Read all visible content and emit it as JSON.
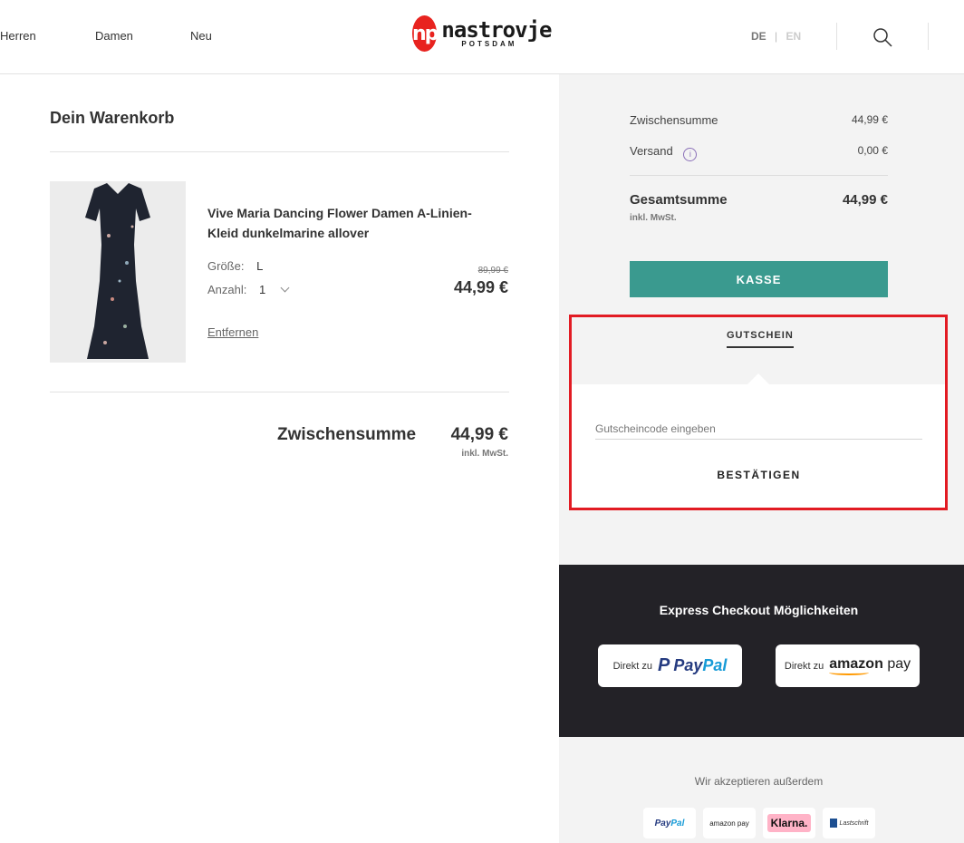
{
  "header": {
    "nav": [
      {
        "label": "Herren"
      },
      {
        "label": "Damen"
      },
      {
        "label": "Neu"
      }
    ],
    "logo": {
      "badge": "np",
      "name": "nastrovje",
      "sub": "POTSDAM"
    },
    "lang": {
      "de": "DE",
      "separator": "|",
      "en": "EN"
    },
    "search_icon": "search-icon"
  },
  "cart": {
    "title": "Dein Warenkorb",
    "item": {
      "name": "Vive Maria Dancing Flower Damen A-Linien-Kleid dunkelmarine allover",
      "size_label": "Größe:",
      "size_value": "L",
      "qty_label": "Anzahl:",
      "qty_value": "1",
      "old_price": "89,99 €",
      "price": "44,99 €",
      "remove": "Entfernen"
    },
    "subtotal_label": "Zwischensumme",
    "subtotal_value": "44,99 €",
    "subtotal_tax": "inkl. MwSt."
  },
  "summary": {
    "subtotal_label": "Zwischensumme",
    "subtotal_value": "44,99 €",
    "shipping_label": "Versand",
    "shipping_info": "i",
    "shipping_value": "0,00 €",
    "total_label": "Gesamtsumme",
    "total_value": "44,99 €",
    "total_tax": "inkl. MwSt.",
    "checkout_button": "KASSE"
  },
  "voucher": {
    "tab": "GUTSCHEIN",
    "placeholder": "Gutscheincode eingeben",
    "confirm": "BESTÄTIGEN"
  },
  "express": {
    "title": "Express Checkout Möglichkeiten",
    "paypal_prefix": "Direkt zu",
    "paypal_p": "P",
    "paypal_pay": "Pay",
    "paypal_pal": "Pal",
    "amazon_prefix": "Direkt zu",
    "amazon_brand": "amazon",
    "amazon_pay": "pay"
  },
  "accept": {
    "label": "Wir akzeptieren außerdem",
    "methods": [
      {
        "pay": "Pay",
        "pal": "Pal"
      },
      {
        "label": "amazon pay"
      },
      {
        "label": "Klarna."
      },
      {
        "label": "Lastschrift"
      }
    ]
  },
  "colors": {
    "accent": "#3a9a8f",
    "highlight": "#e21b23",
    "dark": "#232227",
    "sidebar": "#f3f3f3"
  }
}
